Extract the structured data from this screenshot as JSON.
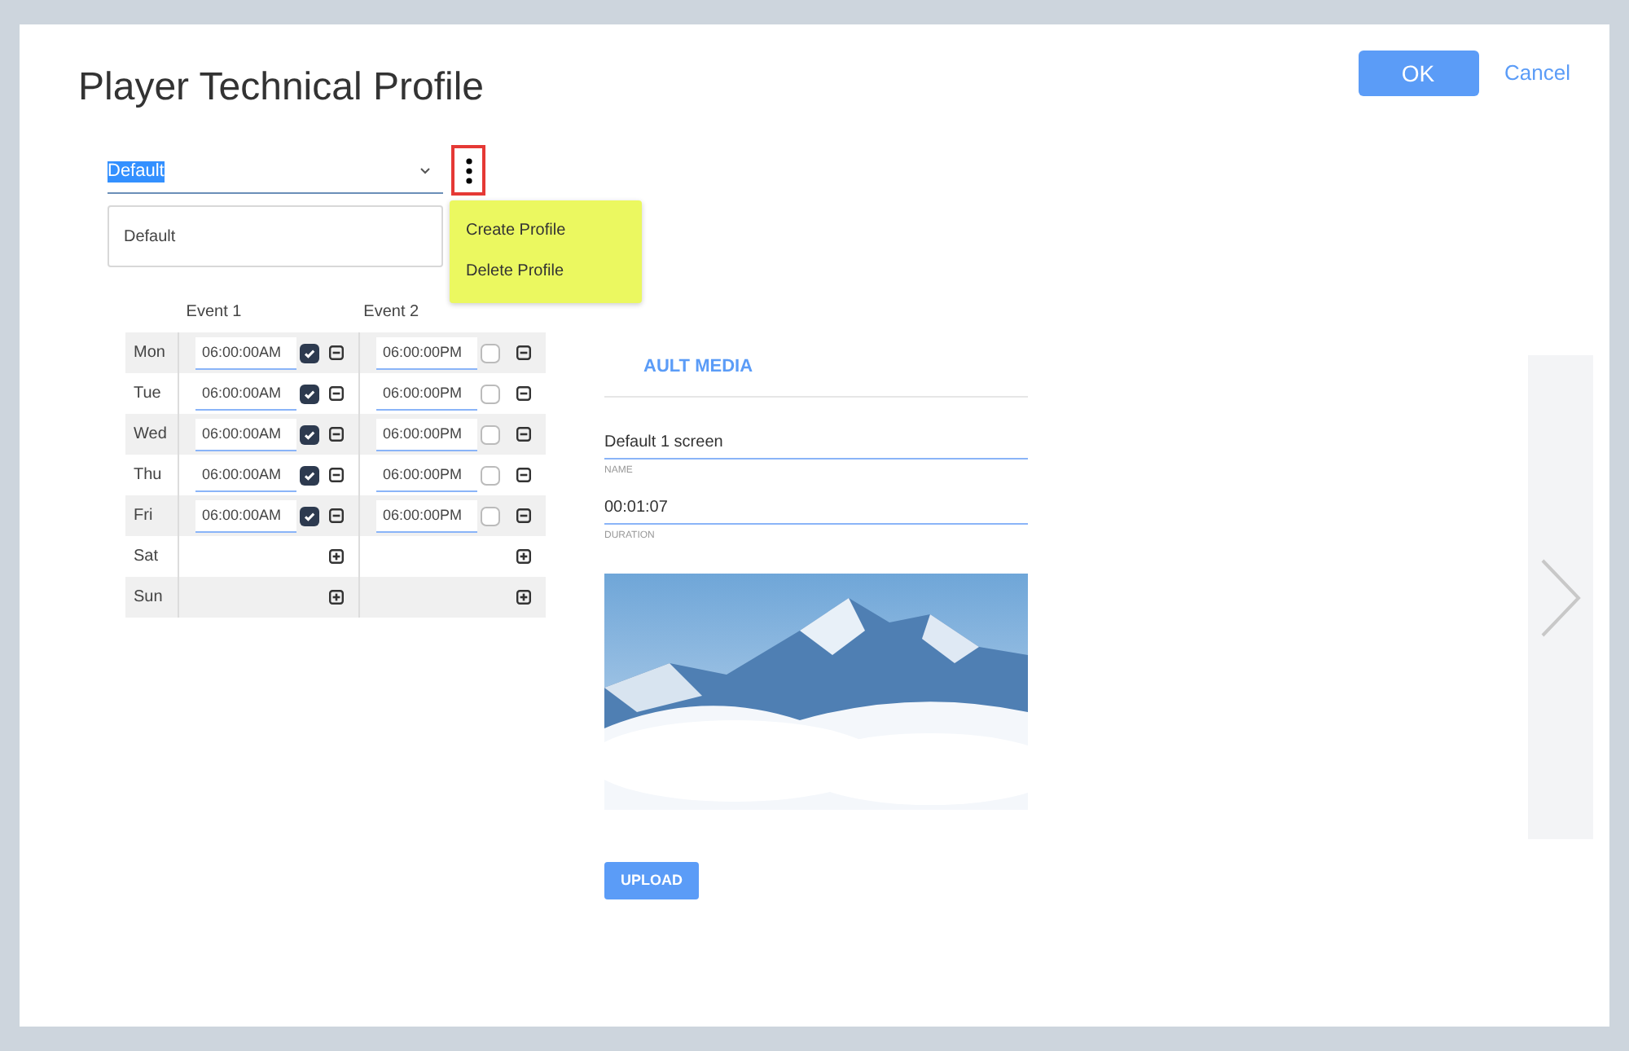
{
  "dialog": {
    "title": "Player Technical Profile",
    "ok": "OK",
    "cancel": "Cancel"
  },
  "profile": {
    "value": "Default",
    "options": [
      "Default"
    ]
  },
  "profile_menu": {
    "items": [
      "Create Profile",
      "Delete Profile"
    ]
  },
  "schedule": {
    "columns": [
      "Event 1",
      "Event 2"
    ],
    "rows": [
      {
        "day": "Mon",
        "events": [
          {
            "kind": "time",
            "time": "06:00:00AM",
            "checked": true
          },
          {
            "kind": "time",
            "time": "06:00:00PM",
            "checked": false
          }
        ]
      },
      {
        "day": "Tue",
        "events": [
          {
            "kind": "time",
            "time": "06:00:00AM",
            "checked": true
          },
          {
            "kind": "time",
            "time": "06:00:00PM",
            "checked": false
          }
        ]
      },
      {
        "day": "Wed",
        "events": [
          {
            "kind": "time",
            "time": "06:00:00AM",
            "checked": true
          },
          {
            "kind": "time",
            "time": "06:00:00PM",
            "checked": false
          }
        ]
      },
      {
        "day": "Thu",
        "events": [
          {
            "kind": "time",
            "time": "06:00:00AM",
            "checked": true
          },
          {
            "kind": "time",
            "time": "06:00:00PM",
            "checked": false
          }
        ]
      },
      {
        "day": "Fri",
        "events": [
          {
            "kind": "time",
            "time": "06:00:00AM",
            "checked": true
          },
          {
            "kind": "time",
            "time": "06:00:00PM",
            "checked": false
          }
        ]
      },
      {
        "day": "Sat",
        "events": [
          {
            "kind": "empty"
          },
          {
            "kind": "empty"
          }
        ]
      },
      {
        "day": "Sun",
        "events": [
          {
            "kind": "empty"
          },
          {
            "kind": "empty"
          }
        ]
      }
    ]
  },
  "media": {
    "tab": "AULT MEDIA",
    "name": "Default 1 screen",
    "name_label": "NAME",
    "duration": "00:01:07",
    "duration_label": "DURATION",
    "upload": "UPLOAD"
  }
}
